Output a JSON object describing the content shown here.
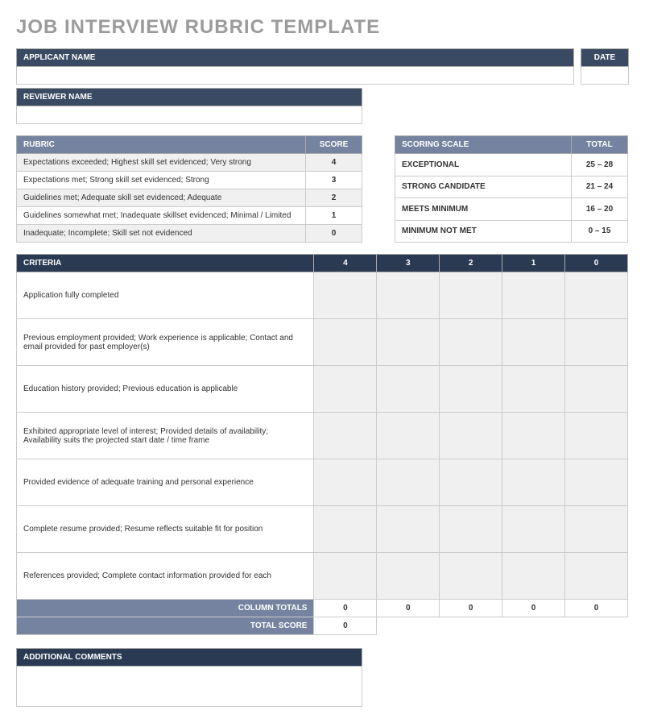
{
  "title": "JOB INTERVIEW RUBRIC TEMPLATE",
  "labels": {
    "applicant_name": "APPLICANT NAME",
    "date": "DATE",
    "reviewer_name": "REVIEWER NAME",
    "rubric": "RUBRIC",
    "score": "SCORE",
    "scoring_scale": "SCORING SCALE",
    "total": "TOTAL",
    "criteria": "CRITERIA",
    "column_totals": "COLUMN TOTALS",
    "total_score": "TOTAL SCORE",
    "additional_comments": "ADDITIONAL COMMENTS"
  },
  "rubric_rows": [
    {
      "desc": "Expectations exceeded; Highest skill set evidenced; Very strong",
      "score": "4"
    },
    {
      "desc": "Expectations met; Strong skill set evidenced; Strong",
      "score": "3"
    },
    {
      "desc": "Guidelines met; Adequate skill set evidenced; Adequate",
      "score": "2"
    },
    {
      "desc": "Guidelines somewhat met; Inadequate skillset evidenced; Minimal / Limited",
      "score": "1"
    },
    {
      "desc": "Inadequate; Incomplete; Skill set not evidenced",
      "score": "0"
    }
  ],
  "scale_rows": [
    {
      "label": "EXCEPTIONAL",
      "range": "25 – 28"
    },
    {
      "label": "STRONG CANDIDATE",
      "range": "21 – 24"
    },
    {
      "label": "MEETS MINIMUM",
      "range": "16 – 20"
    },
    {
      "label": "MINIMUM NOT MET",
      "range": "0 – 15"
    }
  ],
  "criteria_cols": [
    "4",
    "3",
    "2",
    "1",
    "0"
  ],
  "criteria_rows": [
    "Application fully completed",
    "Previous employment provided; Work experience is applicable; Contact and email provided for past employer(s)",
    "Education history provided; Previous education is applicable",
    "Exhibited appropriate level of interest; Provided details of availability; Availability suits the projected start date / time frame",
    "Provided evidence of adequate training and personal experience",
    "Complete resume provided; Resume reflects suitable fit for position",
    "References provided; Complete contact information provided for each"
  ],
  "column_totals": [
    "0",
    "0",
    "0",
    "0",
    "0"
  ],
  "total_score": "0"
}
